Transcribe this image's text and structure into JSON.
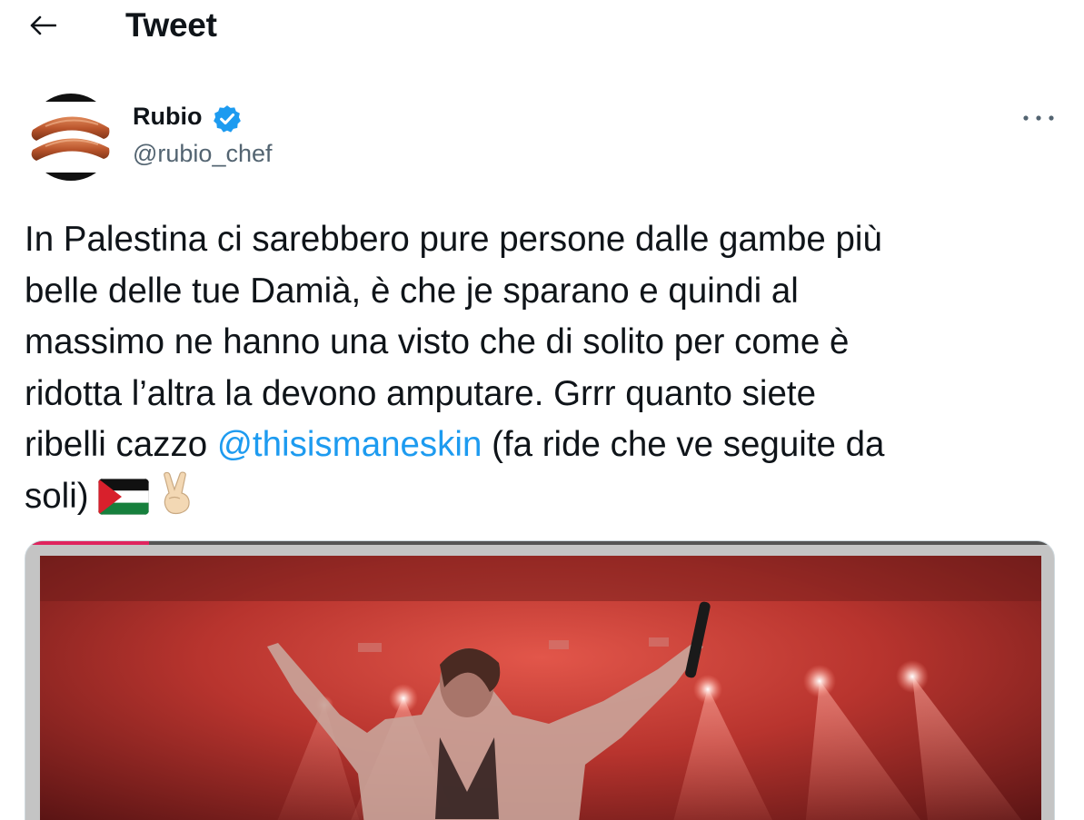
{
  "header": {
    "title": "Tweet"
  },
  "author": {
    "display_name": "Rubio",
    "handle": "@rubio_chef",
    "verified": true
  },
  "tweet": {
    "lines": [
      "In Palestina ci sarebbero pure persone dalle gambe più",
      "belle delle tue Damià, è che je sparano e quindi al",
      "massimo ne hanno una visto che di solito per come è",
      "ridotta l’altra la devono amputare. Grrr quanto siete"
    ],
    "line5_before": "ribelli cazzo ",
    "mention": "@thisismaneskin",
    "line5_after": " (fa ride che ve seguite da",
    "line6": "soli)",
    "emojis": [
      "palestine-flag",
      "victory-hand"
    ]
  },
  "media": {
    "type": "video",
    "progress": 0.12,
    "description_icon": "concert-photo"
  },
  "colors": {
    "accent": "#1d9bf0",
    "text": "#0f1419",
    "secondary": "#536471"
  }
}
